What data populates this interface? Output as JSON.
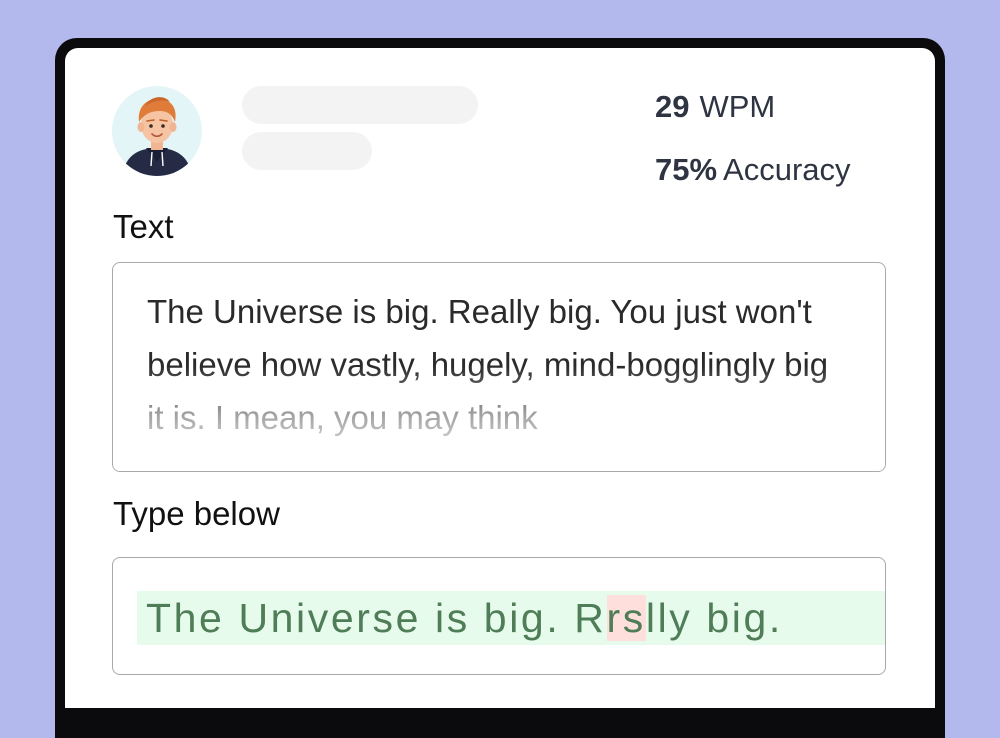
{
  "stats": {
    "wpm_value": "29",
    "wpm_unit": "WPM",
    "accuracy_value": "75%",
    "accuracy_unit": "Accuracy"
  },
  "text_section": {
    "label": "Text",
    "content": "The Universe is big. Really big. You just won't believe how vastly, hugely, mind-bogglingly big it is. I mean, you may think"
  },
  "type_section": {
    "label": "Type below",
    "typed_before": "The Universe is big. R",
    "typed_error": "rs",
    "typed_after": "lly big."
  },
  "colors": {
    "background": "#b3b9ec",
    "correct_highlight": "#e7fbec",
    "error_highlight": "#ffdfdc",
    "typed_text": "#4f7d57"
  },
  "icons": {
    "avatar": "user-avatar-cartoon"
  }
}
